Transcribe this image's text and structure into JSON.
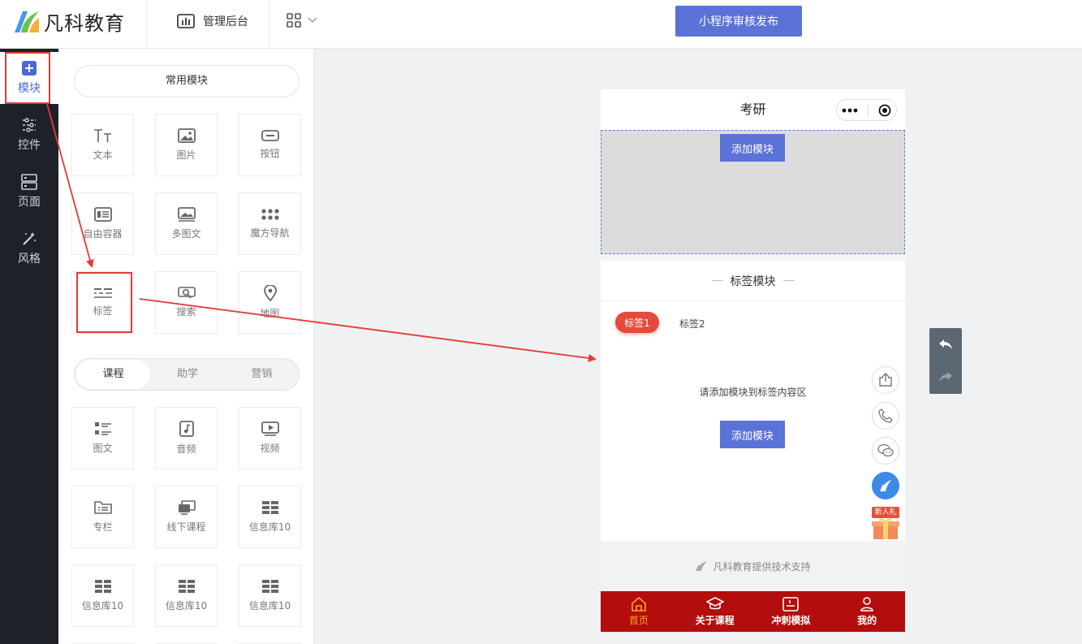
{
  "header": {
    "logo_text": "凡科教育",
    "admin_label": "管理后台",
    "publish_label": "小程序审核发布"
  },
  "rail": {
    "items": [
      {
        "label": "模块",
        "icon": "plus-square-icon"
      },
      {
        "label": "控件",
        "icon": "sliders-icon"
      },
      {
        "label": "页面",
        "icon": "page-layout-icon"
      },
      {
        "label": "风格",
        "icon": "magic-wand-icon"
      }
    ]
  },
  "panel": {
    "common_label": "常用模块",
    "common_modules": [
      "文本",
      "图片",
      "按钮",
      "自由容器",
      "多图文",
      "魔方导航",
      "标签",
      "搜索",
      "地图"
    ],
    "segments": [
      "课程",
      "助学",
      "营销"
    ],
    "course_modules": [
      "图文",
      "音频",
      "视频",
      "专栏",
      "线下课程",
      "信息库10",
      "信息库10",
      "信息库10",
      "信息库10"
    ]
  },
  "preview": {
    "page_title": "考研",
    "add_module_label": "添加模块",
    "tag_module_title": "标签模块",
    "tags": [
      "标签1",
      "标签2"
    ],
    "empty_hint": "请添加模块到标签内容区",
    "add_module_label_2": "添加模块",
    "gift_label": "新人礼",
    "support_text": "凡科教育提供技术支持",
    "tabbar": [
      "首页",
      "关于课程",
      "冲刺模拟",
      "我的"
    ]
  },
  "colors": {
    "accent": "#5b72d7",
    "rail_bg": "#1e2128",
    "tag_active": "#e54a3c",
    "tabbar_bg": "#b30d0d",
    "tabbar_active": "#f5a623",
    "annotation_red": "#e53935"
  }
}
